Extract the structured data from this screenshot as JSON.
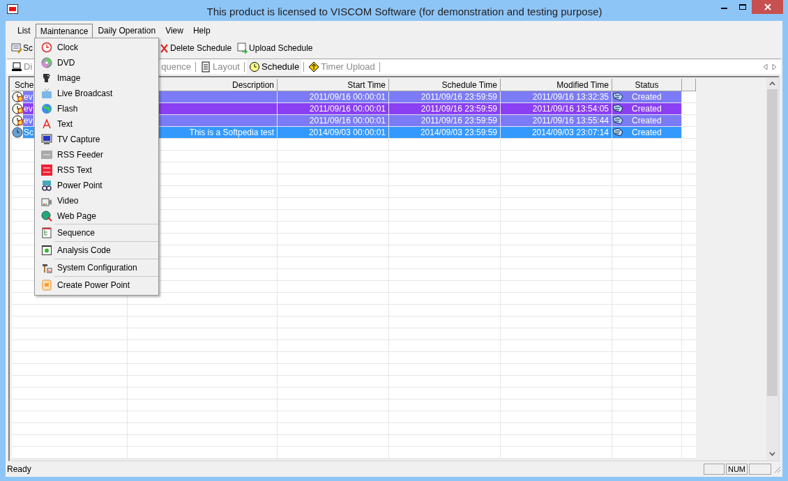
{
  "window": {
    "title": "This product is licensed to VISCOM Software (for demonstration and testing purpose)"
  },
  "menubar": [
    {
      "label": "List",
      "selected": false
    },
    {
      "label": "Maintenance",
      "selected": true
    },
    {
      "label": "Daily Operation",
      "selected": false
    },
    {
      "label": "View",
      "selected": false
    },
    {
      "label": "Help",
      "selected": false
    }
  ],
  "maintenance_menu": {
    "sections": [
      [
        {
          "label": "Clock"
        },
        {
          "label": "DVD"
        },
        {
          "label": "Image"
        },
        {
          "label": "Live Broadcast"
        },
        {
          "label": "Flash"
        },
        {
          "label": "Text"
        },
        {
          "label": "TV Capture"
        },
        {
          "label": "RSS Feeder"
        },
        {
          "label": "RSS Text"
        },
        {
          "label": "Power Point"
        },
        {
          "label": "Video"
        },
        {
          "label": "Web Page"
        }
      ],
      [
        {
          "label": "Sequence"
        }
      ],
      [
        {
          "label": "Analysis Code"
        }
      ],
      [
        {
          "label": "System Configuration"
        }
      ],
      [
        {
          "label": "Create Power Point"
        }
      ]
    ]
  },
  "toolbar": [
    {
      "label": "Sc"
    },
    {
      "label": "Delete Schedule"
    },
    {
      "label": "Upload Schedule"
    }
  ],
  "tabs": [
    {
      "label": "Di",
      "selected": false
    },
    {
      "label": "quence",
      "selected": false
    },
    {
      "label": "Layout",
      "selected": false
    },
    {
      "label": "Schedule",
      "selected": true
    },
    {
      "label": "Timer Upload",
      "selected": false
    }
  ],
  "table": {
    "columns": [
      "Sche",
      "Description",
      "Start Time",
      "Schedule Time",
      "Modified Time",
      "Status"
    ],
    "rows": [
      {
        "color": "#7b7bf7",
        "cells": [
          "ev",
          "",
          "2011/09/16 00:00:01",
          "2011/09/16 23:59:59",
          "2011/09/16 13:32:35",
          "Created"
        ]
      },
      {
        "color": "#8a3ff2",
        "cells": [
          "ev",
          "",
          "2011/09/16 00:00:01",
          "2011/09/16 23:59:59",
          "2011/09/16 13:54:05",
          "Created"
        ]
      },
      {
        "color": "#7b7bf7",
        "cells": [
          "ev",
          "",
          "2011/09/16 00:00:01",
          "2011/09/16 23:59:59",
          "2011/09/16 13:55:44",
          "Created"
        ]
      },
      {
        "color": "#3399ff",
        "cells": [
          "Sc",
          "This is a Softpedia test",
          "2014/09/03 00:00:01",
          "2014/09/03 23:59:59",
          "2014/09/03 23:07:14",
          "Created"
        ]
      }
    ]
  },
  "status_bar": {
    "text": "Ready",
    "num": "NUM"
  }
}
